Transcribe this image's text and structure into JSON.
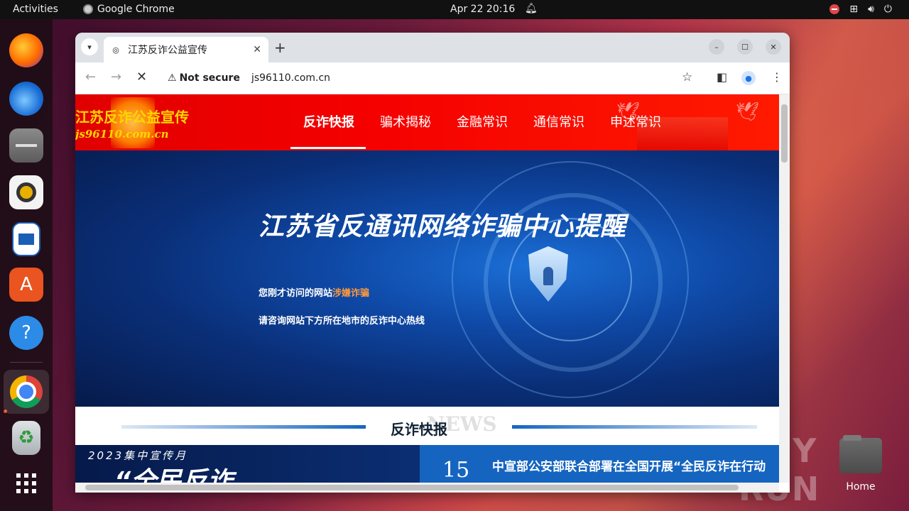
{
  "topbar": {
    "activities": "Activities",
    "app_name": "Google Chrome",
    "clock": "Apr 22  20:16"
  },
  "desktop": {
    "home_label": "Home",
    "watermark": "ANY RUN"
  },
  "browser": {
    "tab_title": "江苏反诈公益宣传",
    "security_label": "Not secure",
    "url": "js96110.com.cn"
  },
  "site": {
    "title": "江苏反诈公益宣传",
    "domain": "js96110.com.cn",
    "nav": [
      "反诈快报",
      "骗术揭秘",
      "金融常识",
      "通信常识",
      "申述常识"
    ],
    "banner": {
      "title": "江苏省反通讯网络诈骗中心提醒",
      "line1_prefix": "您刚才访问的网站",
      "line1_highlight": "涉嫌诈骗",
      "line2": "请咨询网站下方所在地市的反诈中心热线"
    },
    "news": {
      "title": "反诈快报",
      "bg_text": "NEWS",
      "image_caption_top": "2023集中宣传月",
      "image_caption_big": "“全民反诈",
      "day": "15",
      "headline": "中宣部公安部联合部署在全国开展“全民反诈在行动"
    }
  },
  "colors": {
    "header_red": "#f40000",
    "accent_blue": "#1565c0",
    "highlight_orange": "#ff9a3c",
    "title_gold": "#ffd700"
  }
}
